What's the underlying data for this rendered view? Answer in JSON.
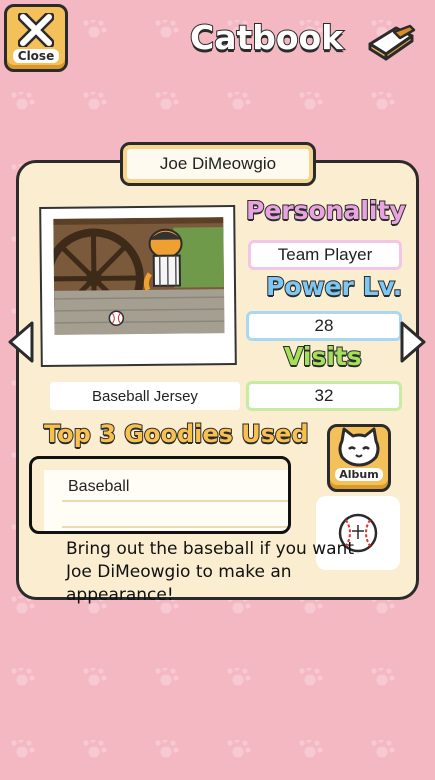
{
  "close_button": {
    "label": "Close",
    "icon": "close-x-icon"
  },
  "header": {
    "title": "Catbook",
    "icon": "book-pencil-icon"
  },
  "cat": {
    "name": "Joe DiMeowgio",
    "memento": "Baseball Jersey",
    "personality_heading": "Personality",
    "personality": "Team Player",
    "power_heading": "Power Lv.",
    "power_level": "28",
    "visits_heading": "Visits",
    "visits": "32"
  },
  "goodies": {
    "heading": "Top 3 Goodies Used",
    "items": [
      "Baseball"
    ],
    "slot_icon": "baseball-icon"
  },
  "album_button": {
    "label": "Album",
    "icon": "cat-face-icon"
  },
  "nav": {
    "prev_icon": "arrow-left-icon",
    "next_icon": "arrow-right-icon"
  },
  "annotation": "Bring out the baseball if you want Joe DiMeowgio to make an appearance!",
  "colors": {
    "background": "#f4b8c3",
    "card": "#fbeed0",
    "button": "#f3c05a",
    "personality": "#e9a3e0",
    "power": "#7ec7f2",
    "visits": "#a4e05a"
  }
}
